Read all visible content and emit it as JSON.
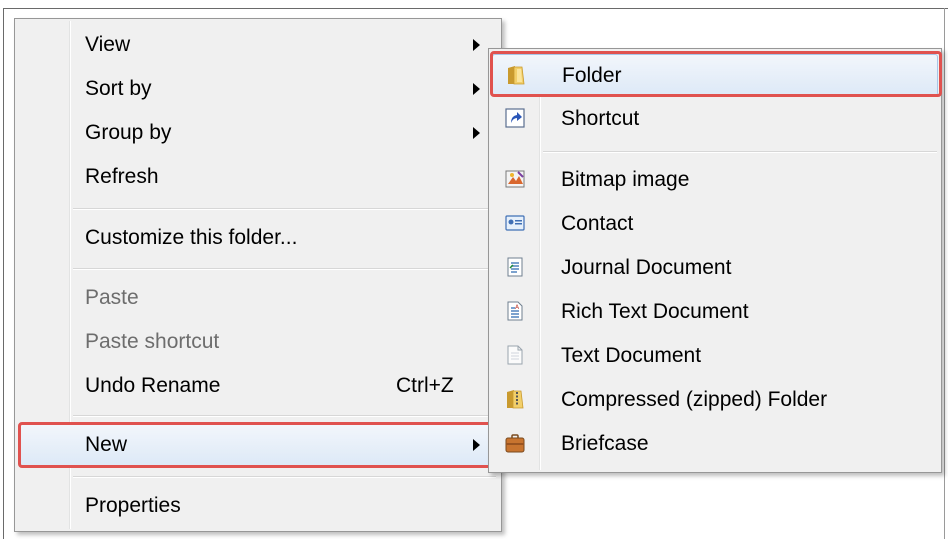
{
  "context_menu": {
    "items": [
      {
        "label": "View"
      },
      {
        "label": "Sort by"
      },
      {
        "label": "Group by"
      },
      {
        "label": "Refresh"
      },
      {
        "label": "Customize this folder..."
      },
      {
        "label": "Paste"
      },
      {
        "label": "Paste shortcut"
      },
      {
        "label": "Undo Rename",
        "shortcut": "Ctrl+Z"
      },
      {
        "label": "New"
      },
      {
        "label": "Properties"
      }
    ]
  },
  "new_submenu": {
    "items": [
      {
        "label": "Folder",
        "icon": "folder-icon"
      },
      {
        "label": "Shortcut",
        "icon": "shortcut-icon"
      },
      {
        "label": "Bitmap image",
        "icon": "bitmap-image-icon"
      },
      {
        "label": "Contact",
        "icon": "contact-icon"
      },
      {
        "label": "Journal Document",
        "icon": "journal-document-icon"
      },
      {
        "label": "Rich Text Document",
        "icon": "rich-text-document-icon"
      },
      {
        "label": "Text Document",
        "icon": "text-document-icon"
      },
      {
        "label": "Compressed (zipped) Folder",
        "icon": "zipped-folder-icon"
      },
      {
        "label": "Briefcase",
        "icon": "briefcase-icon"
      }
    ]
  },
  "colors": {
    "menu_background": "#f0f0f0",
    "hover_border": "#a8c6e8",
    "annotation_highlight": "#e0524f",
    "disabled_text": "#6d6d6d"
  }
}
